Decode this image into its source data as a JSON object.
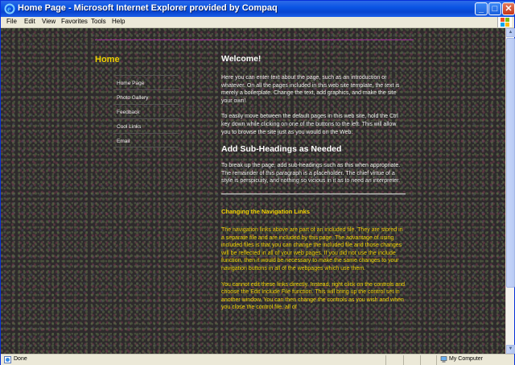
{
  "window": {
    "title": "Home Page - Microsoft Internet Explorer provided by Compaq"
  },
  "menu": {
    "file": "File",
    "edit": "Edit",
    "view": "View",
    "favorites": "Favorites",
    "tools": "Tools",
    "help": "Help"
  },
  "nav": {
    "heading": "Home",
    "items": [
      {
        "label": "Home Page"
      },
      {
        "label": "Photo Gallery"
      },
      {
        "label": "Feedback"
      },
      {
        "label": "Cool Links"
      },
      {
        "label": "Email"
      }
    ]
  },
  "content": {
    "welcome_heading": "Welcome!",
    "welcome_p1": "Here you can enter text about the page, such as an introduction or whatever. On all the pages included in this web site template, the text is merely a boilerplate. Change the text, add graphics, and make the site your own!",
    "welcome_p2": "To easily move between the default pages in this web site, hold the Ctrl key down while clicking on one of the buttons to the left. This will allow you to browse the site just as you would on the Web.",
    "sub_heading": "Add Sub-Headings as Needed",
    "sub_p1": "To break up the page, add sub-headings such as this when appropriate. The remainder of this paragraph is a placeholder. The chief virtue of a style is perspicuity, and nothing so vicious in it as to need an interpreter.",
    "nav_heading": "Changing the Navigation Links",
    "nav_p1": "The navigation links above are part of an included file. They are stored in a separate file and are included by this page. The advantage of using included files is that you can change the included file and those changes will be reflected in all of your web pages. If you did not use the include function, then it would be necessary to make the same changes to your navigation buttons in all of the webpages which use them.",
    "nav_p2": "You cannot edit these links directly. Instead, right click on the controls and choose the Edit Include File function. This will bring up the control set in another window. You can then change the controls as you wish and when you close the control file, all of"
  },
  "status": {
    "text": "Done",
    "zone": "My Computer"
  },
  "colors": {
    "accent_yellow": "#f0d000",
    "rule_purple": "#993399",
    "xp_blue": "#0b55e4"
  }
}
